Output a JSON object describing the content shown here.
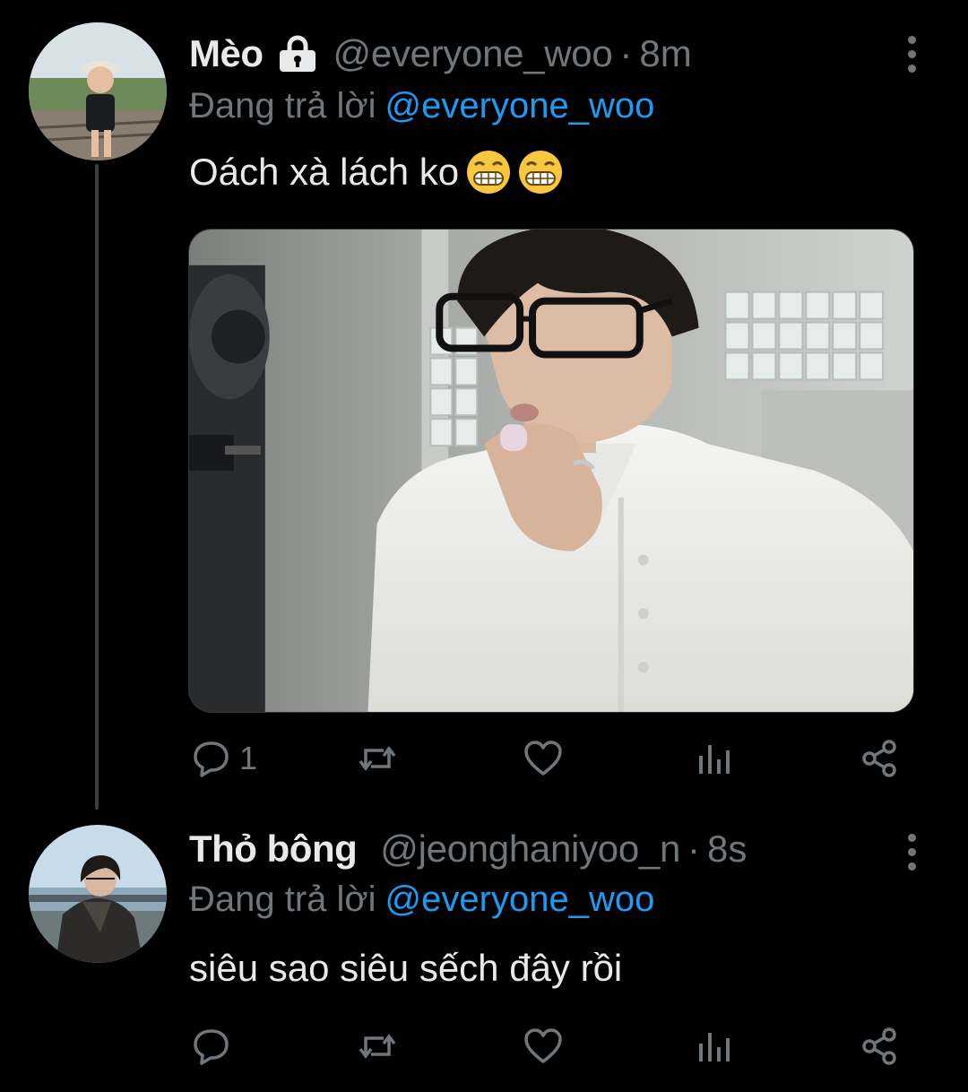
{
  "colors": {
    "background": "#000000",
    "primary_text": "#e7e9ea",
    "secondary_text": "#71767b",
    "mention": "#1d9bf0",
    "thread_line": "#3a3f44"
  },
  "tweets": [
    {
      "display_name": "Mèo",
      "protected_icon": "lock-icon",
      "handle": "@everyone_woo",
      "separator": "·",
      "time": "8m",
      "reply_label": "Đang trả lời",
      "reply_mention": "@everyone_woo",
      "text": "Oách xà lách ko",
      "emojis": [
        "grinning-face-icon",
        "grinning-face-icon"
      ],
      "has_media": true,
      "actions": {
        "reply_count": "1"
      }
    },
    {
      "display_name": "Thỏ bông",
      "handle": "@jeonghaniyoo_n",
      "separator": "·",
      "time": "8s",
      "reply_label": "Đang trả lời",
      "reply_mention": "@everyone_woo",
      "text": "siêu sao siêu sếch đây rồi",
      "has_media": false,
      "actions": {
        "reply_count": ""
      }
    }
  ],
  "icons": {
    "reply": "reply-icon",
    "retweet": "retweet-icon",
    "like": "heart-icon",
    "views": "analytics-icon",
    "share": "share-icon",
    "more": "more-vertical-icon"
  }
}
